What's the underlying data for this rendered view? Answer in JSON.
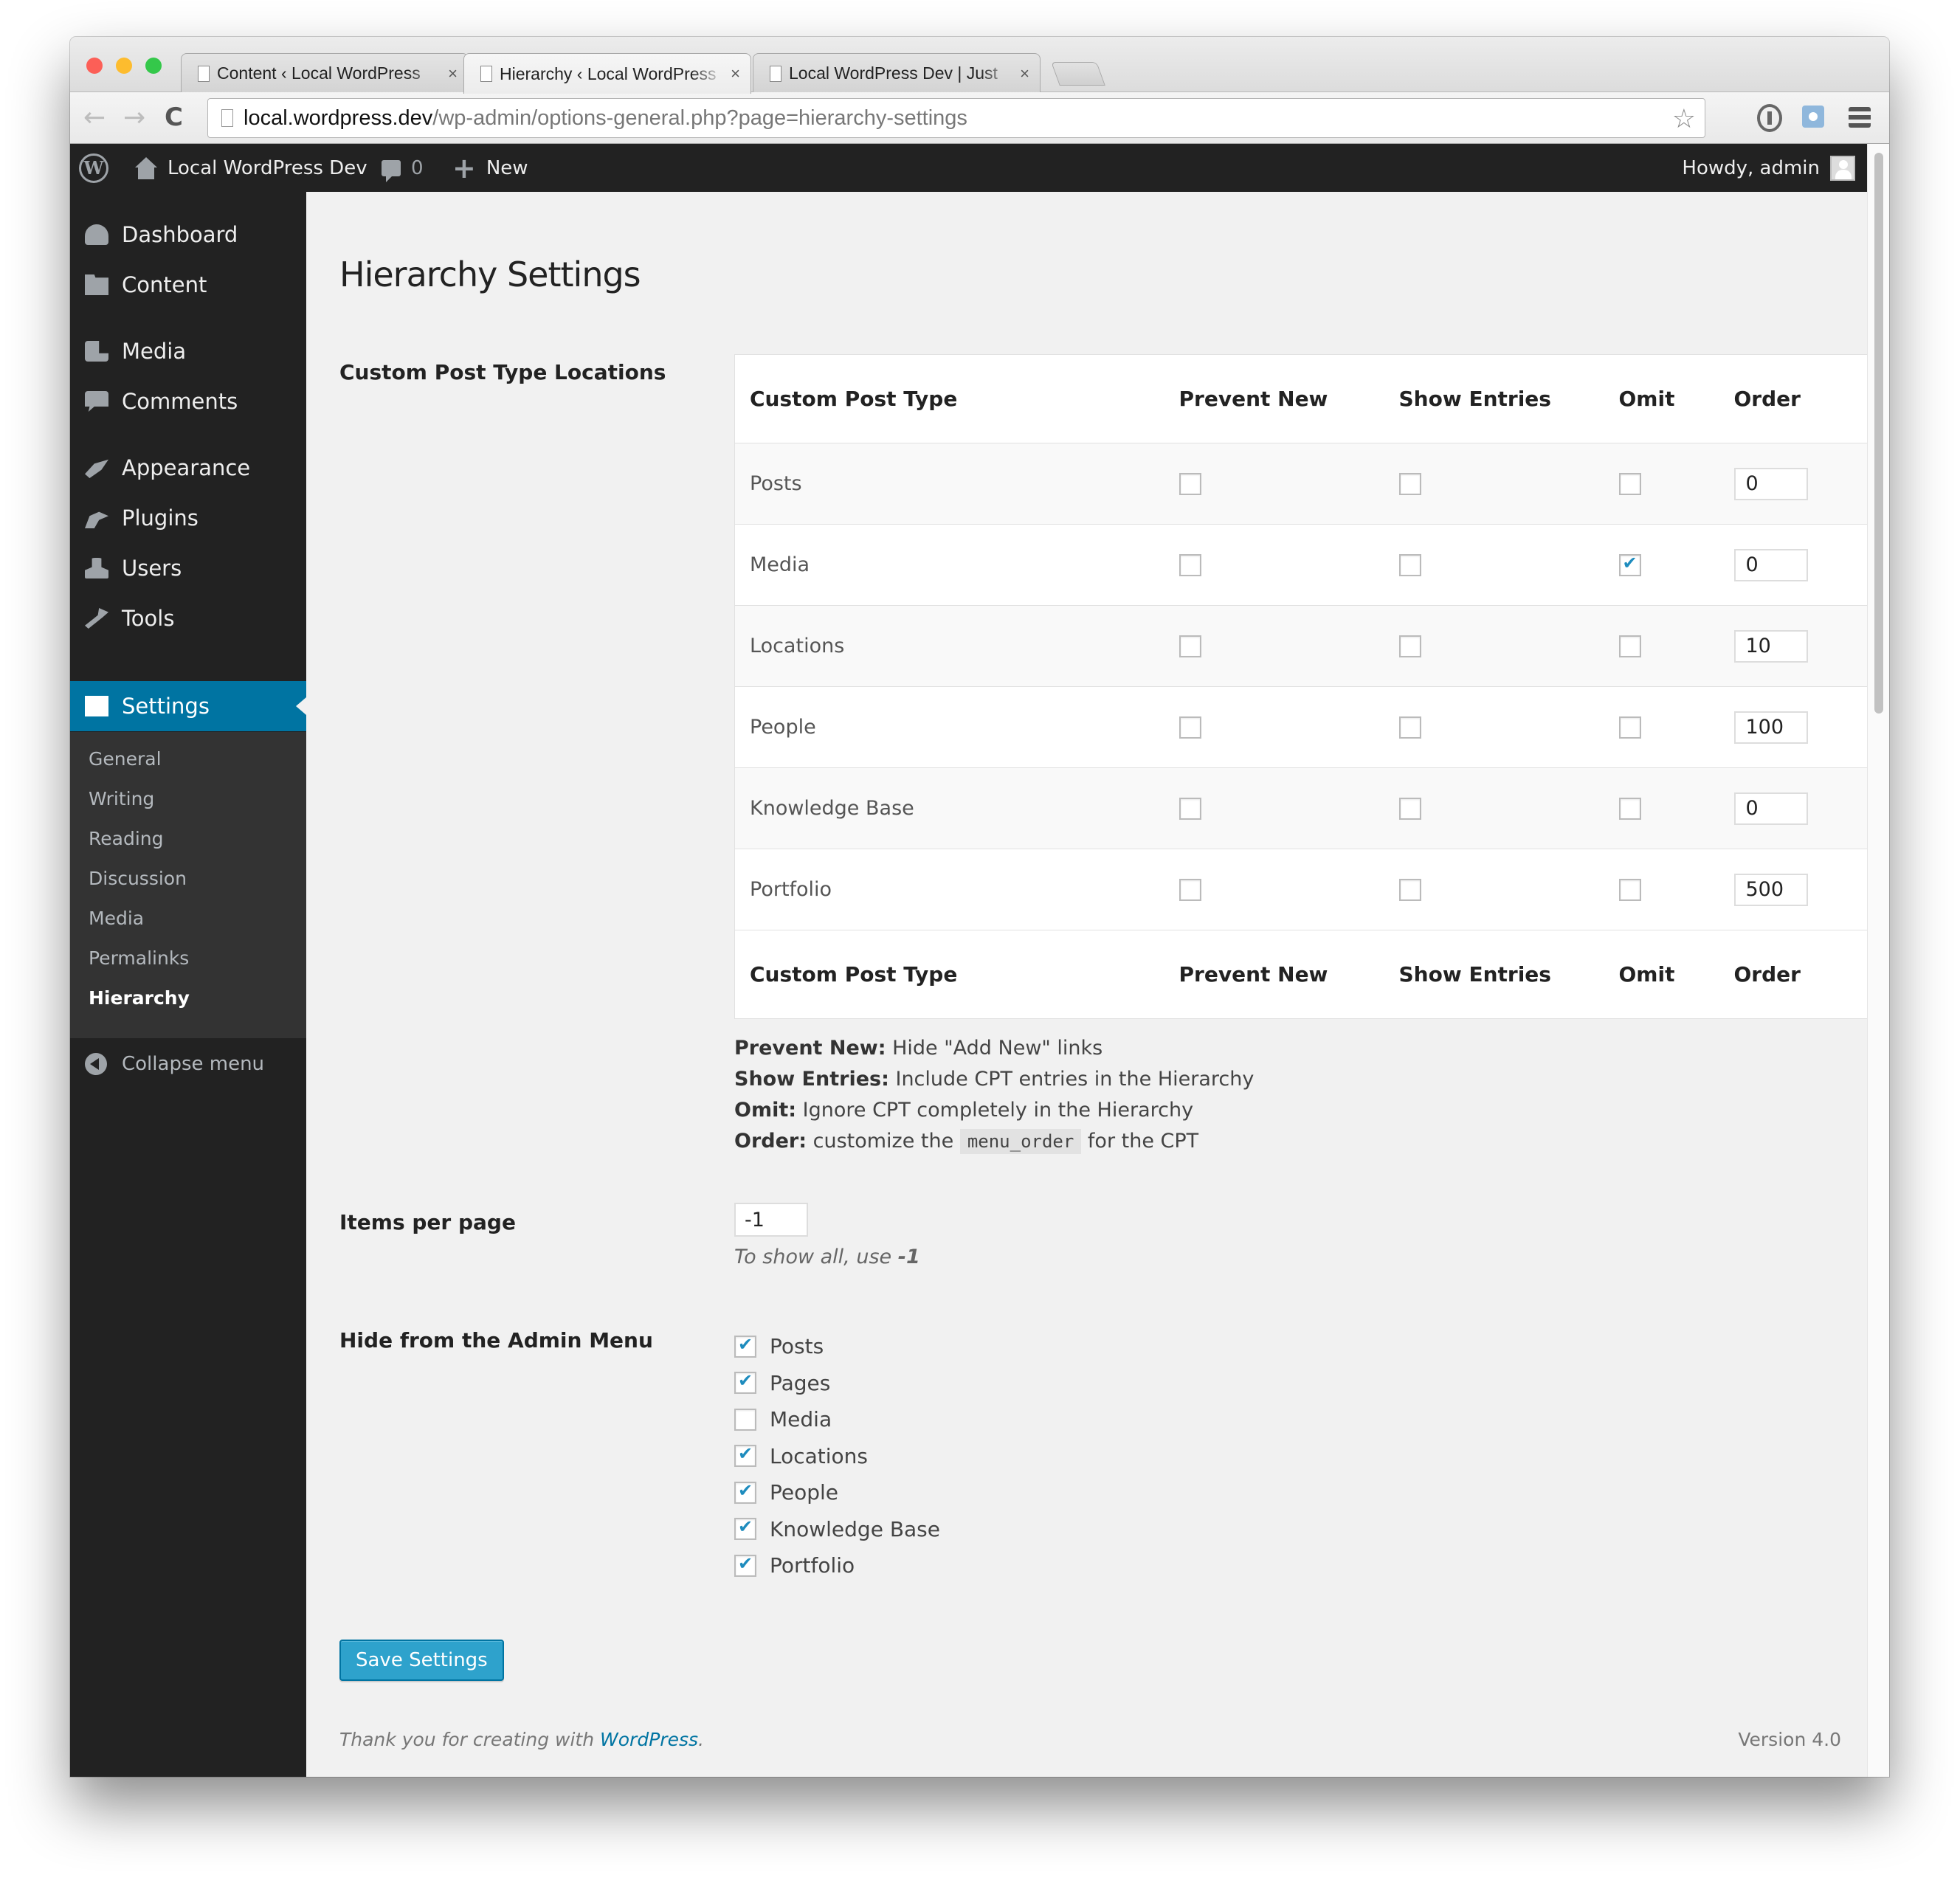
{
  "browser": {
    "tabs": [
      {
        "title": "Content ‹ Local WordPress",
        "close": "×",
        "active": false
      },
      {
        "title": "Hierarchy ‹ Local WordPress",
        "close": "×",
        "active": true
      },
      {
        "title": "Local WordPress Dev | Just",
        "close": "×",
        "active": false
      }
    ],
    "url_host": "local.wordpress.dev",
    "url_path": "/wp-admin/options-general.php?page=hierarchy-settings",
    "icons": {
      "back": "←",
      "forward": "→",
      "reload": "C",
      "star": "☆"
    }
  },
  "adminbar": {
    "logo": "W",
    "site_name": "Local WordPress Dev",
    "comments_count": "0",
    "new_label": "New",
    "howdy": "Howdy, admin"
  },
  "sidebar": {
    "items": [
      {
        "label": "Dashboard",
        "icon": "dashboard-icon"
      },
      {
        "label": "Content",
        "icon": "folder-icon"
      },
      {
        "label": "Media",
        "icon": "media-icon"
      },
      {
        "label": "Comments",
        "icon": "comments-icon"
      },
      {
        "label": "Appearance",
        "icon": "appearance-icon"
      },
      {
        "label": "Plugins",
        "icon": "plugins-icon"
      },
      {
        "label": "Users",
        "icon": "users-icon"
      },
      {
        "label": "Tools",
        "icon": "tools-icon"
      },
      {
        "label": "Settings",
        "icon": "settings-icon",
        "current": true
      }
    ],
    "submenu": [
      "General",
      "Writing",
      "Reading",
      "Discussion",
      "Media",
      "Permalinks",
      "Hierarchy"
    ],
    "submenu_current": "Hierarchy",
    "collapse_label": "Collapse menu"
  },
  "page": {
    "title": "Hierarchy Settings",
    "cpt_section_label": "Custom Post Type Locations",
    "table": {
      "columns": [
        "Custom Post Type",
        "Prevent New",
        "Show Entries",
        "Omit",
        "Order"
      ],
      "rows": [
        {
          "name": "Posts",
          "prevent_new": false,
          "show_entries": false,
          "omit": false,
          "order": "0"
        },
        {
          "name": "Media",
          "prevent_new": false,
          "show_entries": false,
          "omit": true,
          "order": "0"
        },
        {
          "name": "Locations",
          "prevent_new": false,
          "show_entries": false,
          "omit": false,
          "order": "10"
        },
        {
          "name": "People",
          "prevent_new": false,
          "show_entries": false,
          "omit": false,
          "order": "100"
        },
        {
          "name": "Knowledge Base",
          "prevent_new": false,
          "show_entries": false,
          "omit": false,
          "order": "0"
        },
        {
          "name": "Portfolio",
          "prevent_new": false,
          "show_entries": false,
          "omit": false,
          "order": "500"
        }
      ]
    },
    "legend": [
      {
        "term": "Prevent New:",
        "desc": "Hide \"Add New\" links"
      },
      {
        "term": "Show Entries:",
        "desc": "Include CPT entries in the Hierarchy"
      },
      {
        "term": "Omit:",
        "desc": "Ignore CPT completely in the Hierarchy"
      },
      {
        "term": "Order:",
        "desc_before": "customize the",
        "code": "menu_order",
        "desc_after": "for the CPT"
      }
    ],
    "items_per_page_label": "Items per page",
    "items_per_page_value": "-1",
    "items_per_page_hint": "To show all, use",
    "items_per_page_hint_value": "-1",
    "hide_menu_label": "Hide from the Admin Menu",
    "hide_menu_items": [
      {
        "label": "Posts",
        "checked": true
      },
      {
        "label": "Pages",
        "checked": true
      },
      {
        "label": "Media",
        "checked": false
      },
      {
        "label": "Locations",
        "checked": true
      },
      {
        "label": "People",
        "checked": true
      },
      {
        "label": "Knowledge Base",
        "checked": true
      },
      {
        "label": "Portfolio",
        "checked": true
      }
    ],
    "save_label": "Save Settings"
  },
  "footer": {
    "thanks": "Thank you for creating with",
    "link": "WordPress",
    "period": ".",
    "version": "Version 4.0"
  },
  "colors": {
    "accent": "#0074a2",
    "button": "#2ea2cc",
    "check": "#1e8cbe",
    "adminbar": "#222222"
  }
}
